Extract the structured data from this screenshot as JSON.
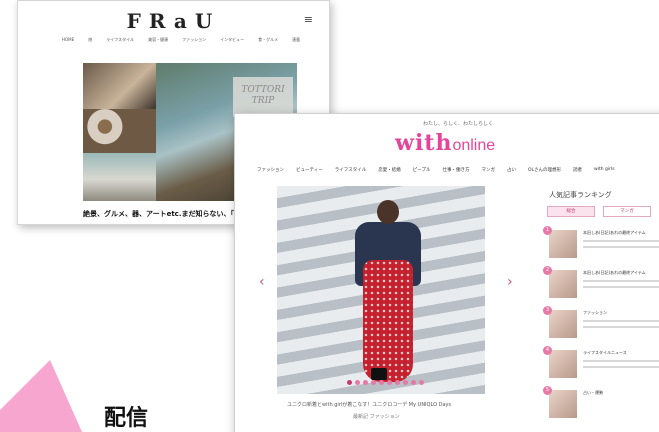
{
  "frau": {
    "logo": "FRaU",
    "menu_icon": "≡",
    "nav": [
      "HOME",
      "旅",
      "ライフスタイル",
      "美容・健康",
      "ファッション",
      "インタビュー",
      "食・グルメ",
      "連載"
    ],
    "overlay_text_line1": "TOTTORI",
    "overlay_text_line2": "TRIP",
    "caption": "絶景、グルメ、器、アートetc.まだ知らない、「鳥取」の旅へ"
  },
  "with": {
    "tagline": "わたし、らしく、わたしらしく",
    "logo_big": "with",
    "logo_small": "online",
    "nav": [
      "ファッション",
      "ビューティー",
      "ライフスタイル",
      "恋愛・結婚",
      "ピープル",
      "仕事・働き方",
      "マンガ",
      "占い",
      "OLさんの理想形",
      "読者",
      "with girls"
    ],
    "arrow_left": "‹",
    "arrow_right": "›",
    "hero_caption": "ユニクロ新着とwith girlが着こなす！ユニクロコーデ My UNIQLO Days",
    "hero_sub": "最新記 ファッション",
    "ranking_title": "人気記事ランキング",
    "ranking_tabs": [
      "総合",
      "マンガ"
    ],
    "ranking": [
      {
        "num": "1",
        "category": "本田しあ(日記)あれの最終アイテム",
        "excerpt": "話題を集める一方"
      },
      {
        "num": "2",
        "category": "本田しあ(日記)あれの最終アイテム",
        "excerpt": "話題を集める一方"
      },
      {
        "num": "3",
        "category": "ファッション",
        "excerpt": "夏の大定番アイテム"
      },
      {
        "num": "4",
        "category": "ライフスタイルニュース",
        "excerpt": "新ブランド情報"
      },
      {
        "num": "5",
        "category": "占い・運勢",
        "excerpt": "今週の占い"
      }
    ]
  },
  "label_bottom": "配信"
}
